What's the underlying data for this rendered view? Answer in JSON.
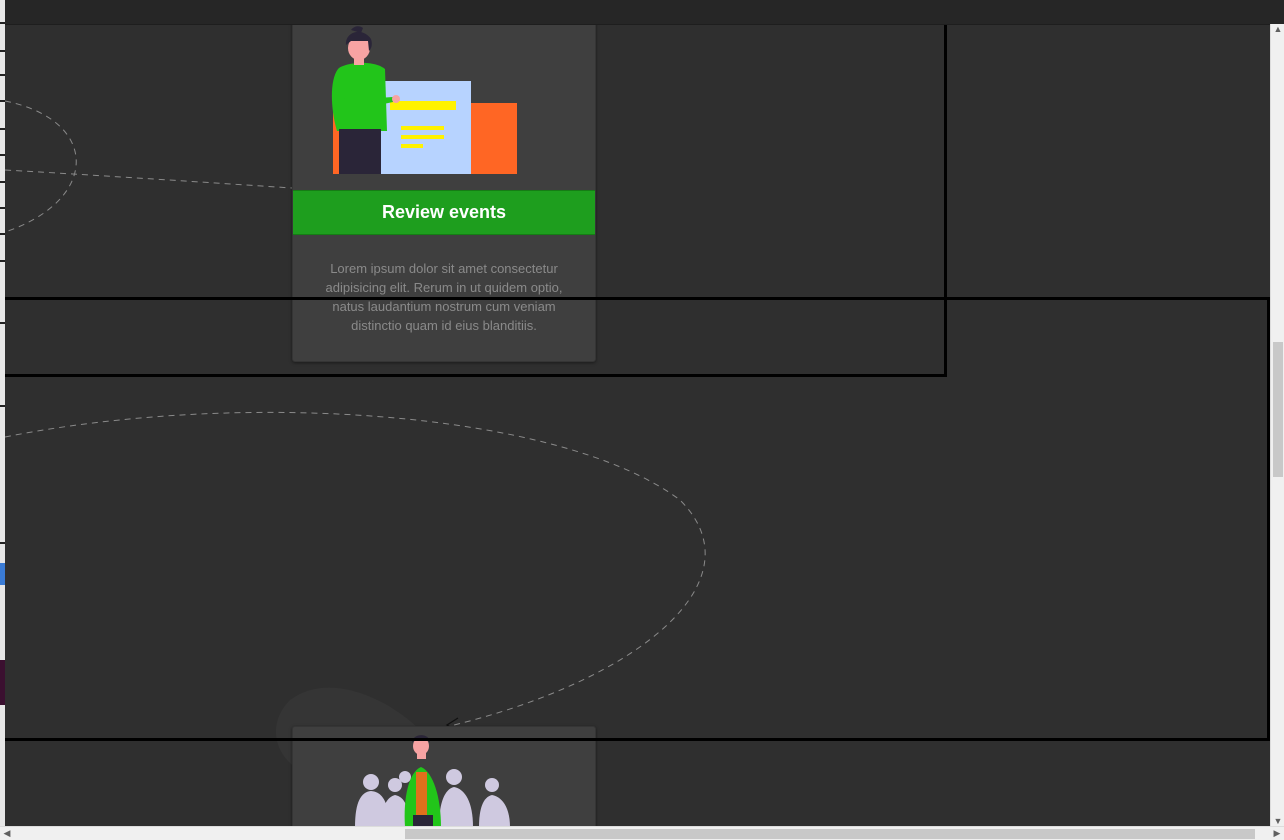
{
  "cards": [
    {
      "title": "Review events",
      "description": "Lorem ipsum dolor sit amet consectetur adipisicing elit. Rerum in ut quidem optio, natus laudantium nostrum cum veniam distinctio quam id eius blanditiis.",
      "illustration": "person-presenting-document-illustration"
    },
    {
      "title": "",
      "description": "",
      "illustration": "team-group-illustration"
    }
  ],
  "colors": {
    "background": "#2f2f2f",
    "card": "#3f3f3f",
    "accent_green": "#1e9e1e",
    "illustration_green": "#22c51a",
    "illustration_orange": "#ff6624",
    "document_blue": "#b7d3ff",
    "highlight_yellow": "#fff200",
    "silhouette": "#cfc9e0",
    "dashed_line": "#8a8a8a"
  }
}
